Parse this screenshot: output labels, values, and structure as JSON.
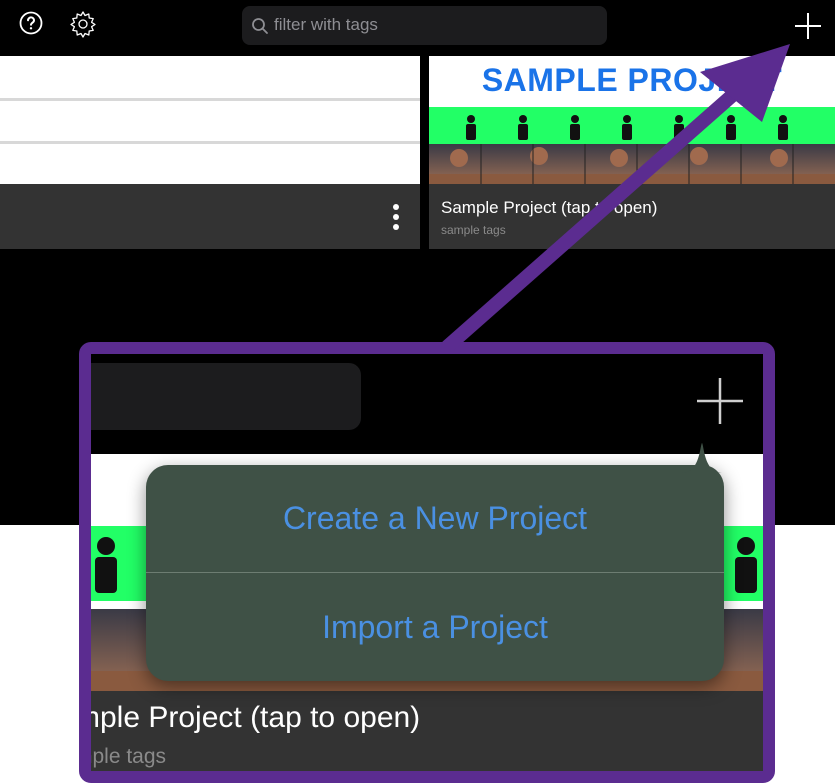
{
  "toolbar": {
    "help_icon": "question-circle-icon",
    "settings_icon": "gear-icon",
    "add_icon": "plus-icon",
    "search_placeholder": "filter with tags"
  },
  "projects": [
    {
      "title": "",
      "tags": ""
    },
    {
      "title": "Sample Project (tap to open)",
      "tags": "sample tags",
      "thumbnail_title": "SAMPLE PROJECT"
    }
  ],
  "zoom_callout": {
    "card_title": "mple Project (tap to open)",
    "card_tags": "mple tags",
    "menu": {
      "create_label": "Create a New Project",
      "import_label": "Import a Project"
    }
  },
  "colors": {
    "accent_blue": "#4a90e2",
    "callout_border": "#5b2c90",
    "arrow": "#5b2c90",
    "popover_bg": "#3f5146",
    "green_screen": "#22ff66"
  }
}
